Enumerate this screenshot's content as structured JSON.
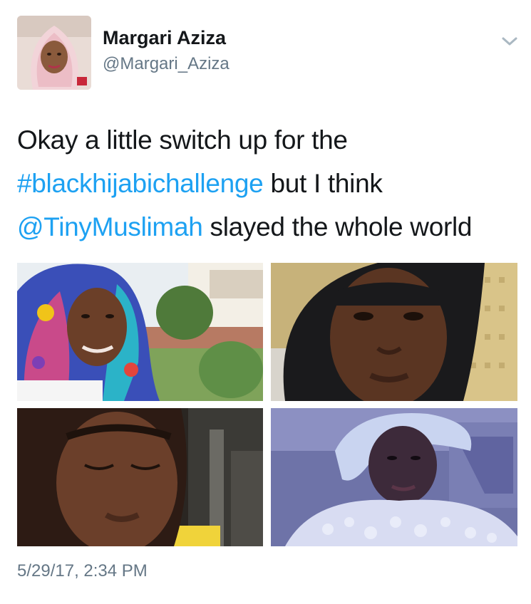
{
  "author": {
    "display_name": "Margari Aziza",
    "handle": "@Margari_Aziza",
    "avatar_icon": "profile-photo"
  },
  "menu": {
    "icon": "chevron-down-icon"
  },
  "tweet": {
    "line1": "Okay a little switch up for the",
    "hashtag": "#blackhijabichallenge",
    "line2_rest": " but I think",
    "mention": "@TinyMuslimah",
    "line3_rest": " slayed the whole world"
  },
  "media": [
    {
      "description_icon": "photo-colorful-hijab-garden"
    },
    {
      "description_icon": "photo-black-hijab-closeup"
    },
    {
      "description_icon": "photo-dark-hijab-eyes-closed"
    },
    {
      "description_icon": "photo-white-headwrap"
    }
  ],
  "timestamp": "5/29/17, 2:34 PM",
  "colors": {
    "text": "#14171a",
    "secondary": "#657786",
    "link": "#1da1f2"
  }
}
